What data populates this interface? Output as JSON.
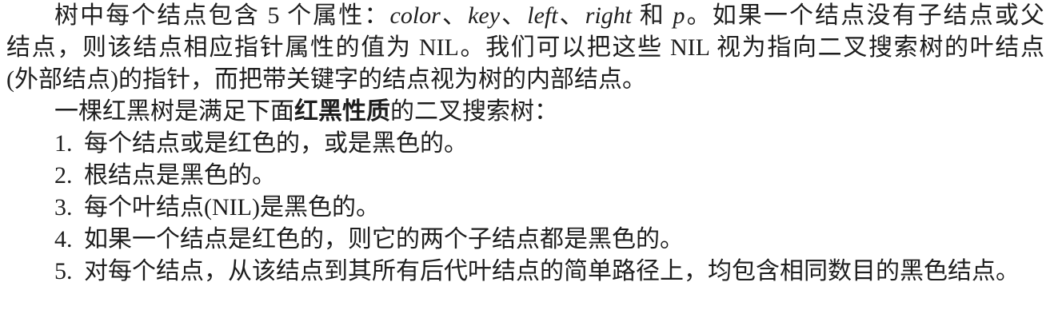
{
  "page": {
    "background": "#ffffff",
    "text_color": "#1e1e1e"
  },
  "intro": {
    "line1": {
      "lead": "树中每个结点包含 5 个属性：",
      "attr_color": "color",
      "sep1": "、",
      "attr_key": "key",
      "sep2": "、",
      "attr_left": "left",
      "sep3": "、",
      "attr_right": "right",
      "conj": " 和 ",
      "attr_p": "p",
      "tail": "。如果一个结点没有子结点或父"
    },
    "line2": "结点，则该结点相应指针属性的值为 NIL。我们可以把这些 NIL 视为指向二叉搜索树的叶结点",
    "line3": "(外部结点)的指针，而把带关键字的结点视为树的内部结点。"
  },
  "definition": {
    "lead": "一棵红黑树是满足下面",
    "term": "红黑性质",
    "tail": "的二叉搜索树："
  },
  "properties": [
    {
      "number": "1.",
      "text": "每个结点或是红色的，或是黑色的。"
    },
    {
      "number": "2.",
      "text": "根结点是黑色的。"
    },
    {
      "number": "3.",
      "text": "每个叶结点(NIL)是黑色的。"
    },
    {
      "number": "4.",
      "text": "如果一个结点是红色的，则它的两个子结点都是黑色的。"
    },
    {
      "number": "5.",
      "text": "对每个结点，从该结点到其所有后代叶结点的简单路径上，均包含相同数目的黑色结点。"
    }
  ]
}
